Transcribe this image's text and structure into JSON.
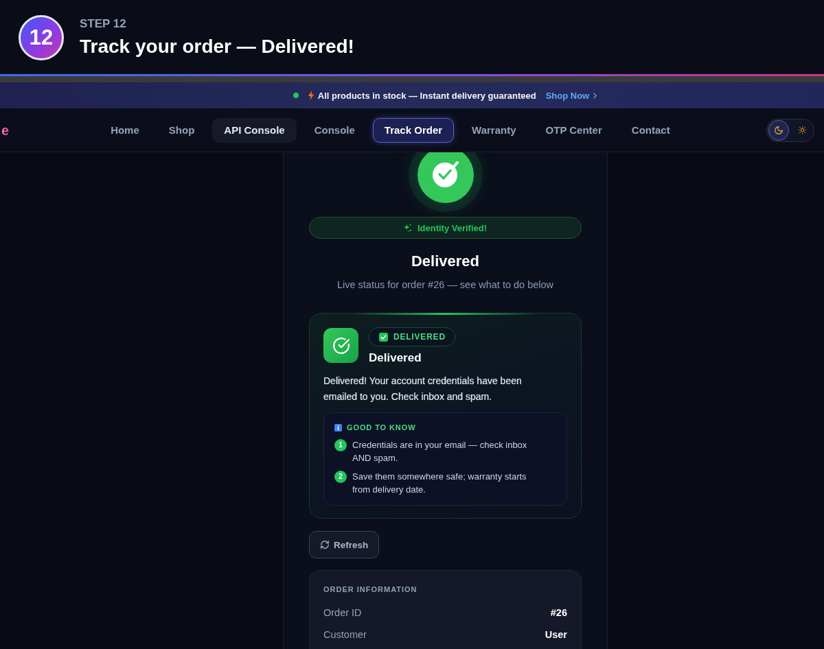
{
  "header": {
    "step_number": "12",
    "step_label": "STEP 12",
    "title": "Track your order — Delivered!"
  },
  "announcement": {
    "text": "All products in stock — Instant delivery guaranteed",
    "link": "Shop Now"
  },
  "navbar": {
    "logo_text": "e",
    "items": [
      {
        "label": "Home",
        "selected": false,
        "hovered": false
      },
      {
        "label": "Shop",
        "selected": false,
        "hovered": false
      },
      {
        "label": "API Console",
        "selected": false,
        "hovered": true
      },
      {
        "label": "Console",
        "selected": false,
        "hovered": false
      },
      {
        "label": "Track Order",
        "selected": true,
        "hovered": false
      },
      {
        "label": "Warranty",
        "selected": false,
        "hovered": false
      },
      {
        "label": "OTP Center",
        "selected": false,
        "hovered": false
      },
      {
        "label": "Contact",
        "selected": false,
        "hovered": false
      }
    ],
    "theme_toggle": [
      {
        "kind": "moon",
        "selected": true
      },
      {
        "kind": "sun",
        "selected": false
      }
    ]
  },
  "hero": {
    "badge": "Identity Verified!",
    "title": "Delivered",
    "subtitle": "Live status for order #26 — see what to do below"
  },
  "status_card": {
    "badge": "DELIVERED",
    "title": "Delivered",
    "message": "Delivered! Your account credentials have been emailed to you. Check inbox and spam.",
    "tips": {
      "heading": "GOOD TO KNOW",
      "items": [
        {
          "number": "1",
          "text": "Credentials are in your email — check inbox AND spam."
        },
        {
          "number": "2",
          "text": "Save them somewhere safe; warranty starts from delivery date."
        }
      ]
    }
  },
  "refresh_button": "Refresh",
  "order_information": {
    "heading": "ORDER INFORMATION",
    "rows": [
      {
        "label": "Order ID",
        "value": "#26"
      },
      {
        "label": "Customer",
        "value": "User"
      }
    ]
  }
}
